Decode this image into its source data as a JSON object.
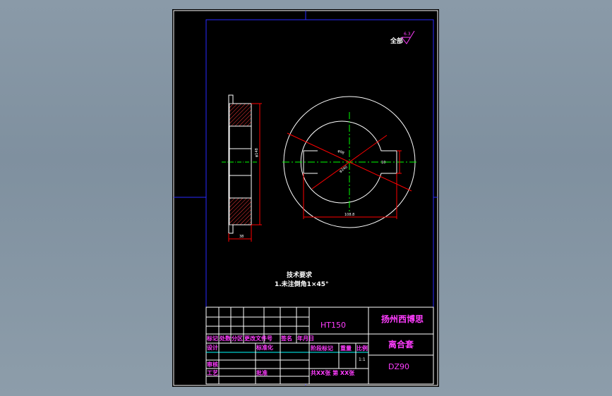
{
  "surface_finish": {
    "label": "全部",
    "value": "6.3"
  },
  "technical_requirements": {
    "heading": "技术要求",
    "items": [
      "1.未注倒角1×45°"
    ]
  },
  "side_view": {
    "dim_diameter": "φ148",
    "dim_width": "38"
  },
  "front_view": {
    "dim_bore": "φ98",
    "dim_outer": "φ240",
    "dim_keyway_width": "10",
    "dim_keyway_depth": "108.8"
  },
  "title_block": {
    "material": "HT150",
    "company_line1": "扬州西博思",
    "part_name": "离合套",
    "drawing_number": "DZ90",
    "header_row": [
      "标记",
      "处数",
      "分区",
      "更改文件号",
      "签名",
      "年月日"
    ],
    "designer_label": "设计",
    "standardize_label": "标准化",
    "review_label": "审核",
    "process_label": "工艺",
    "approve_label": "批准",
    "stage_labels": [
      "阶段标记",
      "重量",
      "比例"
    ],
    "scale": "1:1",
    "sheet_info": "共XX张 第 XX张"
  },
  "colors": {
    "sheet": "#000000",
    "border": "#ffffff",
    "frame": "#2020ff",
    "dimension": "#ff0000",
    "centerline": "#00ff00",
    "hatch": "#ff3a3a",
    "title_text": "#ff3dff",
    "cyan_line": "#00ffff"
  }
}
